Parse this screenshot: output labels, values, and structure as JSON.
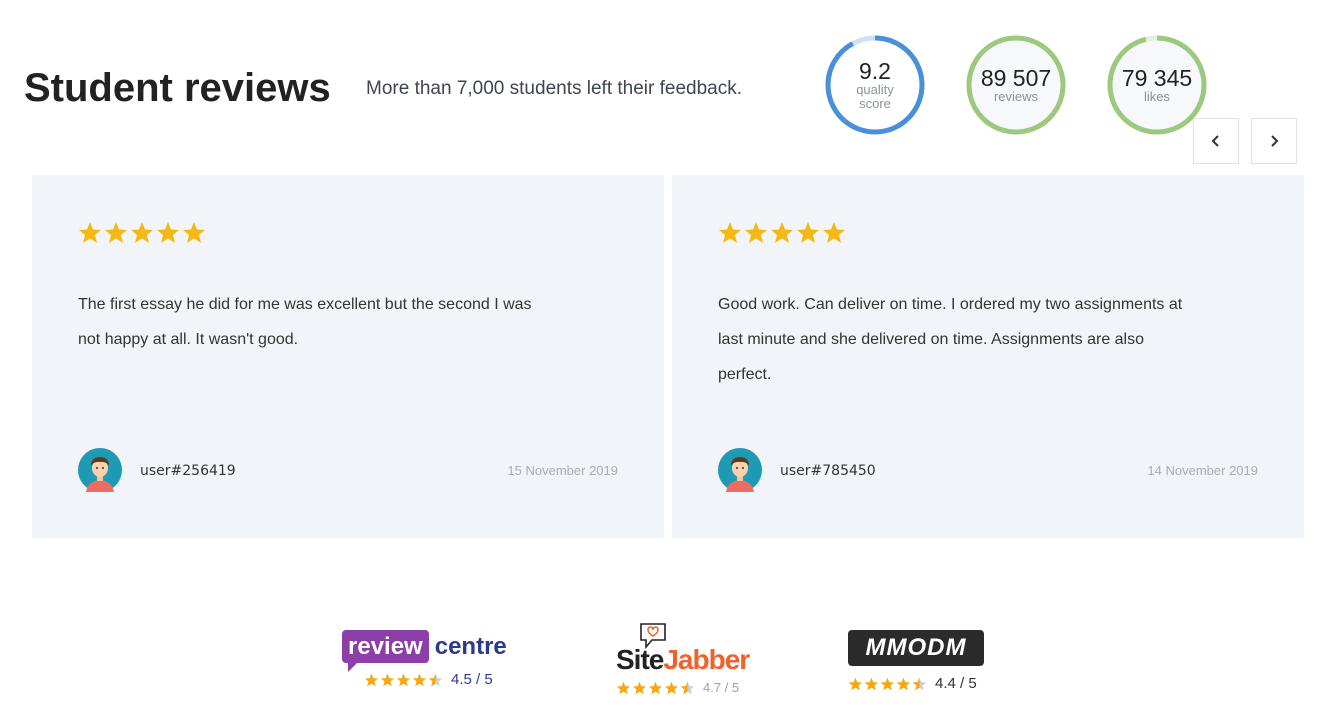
{
  "header": {
    "title": "Student reviews",
    "subtitle": "More than 7,000 students left their feedback."
  },
  "stats": [
    {
      "value": "9.2",
      "label_line1": "quality",
      "label_line2": "score",
      "color": "#4a8fd9",
      "track": "#cfe0f3",
      "fill_fraction": 0.92
    },
    {
      "value": "89 507",
      "label_line1": "reviews",
      "color": "#9cc97e",
      "track": "#e3f0da",
      "fill_fraction": 1.0
    },
    {
      "value": "79 345",
      "label_line1": "likes",
      "color": "#9cc97e",
      "track": "#e3f0da",
      "fill_fraction": 0.96
    }
  ],
  "carousel": {
    "prev_icon": "chevron-left-icon",
    "next_icon": "chevron-right-icon"
  },
  "reviews": [
    {
      "rating": 5,
      "text": "The first essay he did for me was excellent but the second I was not happy at all. It wasn't good.",
      "user": "user#256419",
      "date": "15 November 2019"
    },
    {
      "rating": 5,
      "text": "Good work. Can deliver on time. I ordered my two assignments at last minute and she delivered on time. Assignments are also perfect.",
      "user": "user#785450",
      "date": "14 November 2019"
    }
  ],
  "ratings": [
    {
      "name_part1": "review",
      "name_part2": "centre",
      "rating": "4.5 / 5",
      "stars": 4.5
    },
    {
      "name_part1": "Site",
      "name_part2": "Jabber",
      "rating": "4.7 / 5",
      "stars": 4.5
    },
    {
      "name": "MMODM",
      "rating": "4.4 / 5",
      "stars": 4.5
    }
  ],
  "colors": {
    "star": "#f5b915",
    "card_bg": "#f1f5f9",
    "review_centre_purple": "#8b3fa7",
    "sitejabber_orange": "#f0622d"
  }
}
